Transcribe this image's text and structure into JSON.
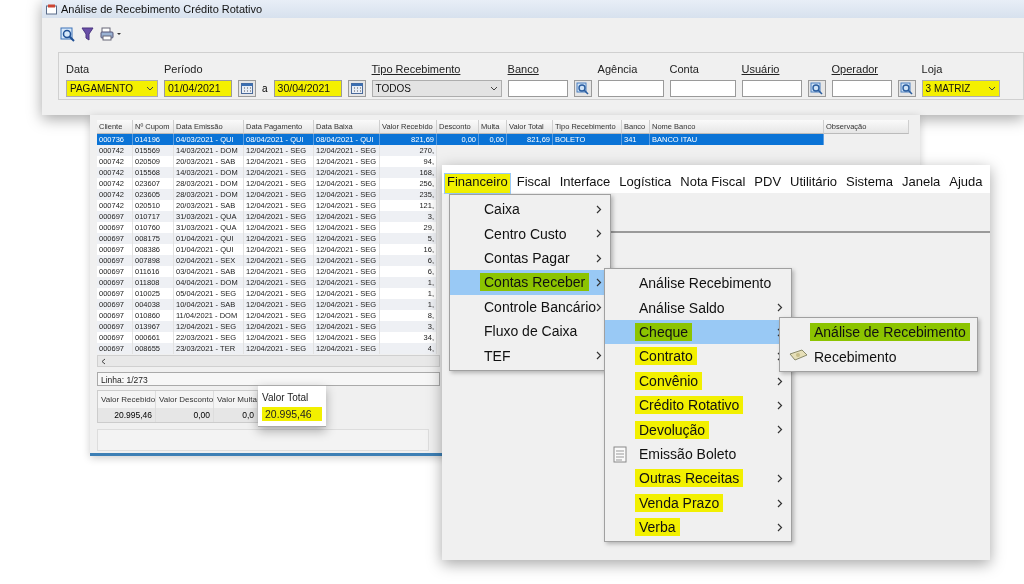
{
  "filter_window": {
    "title": "Análise de Recebimento Crédito Rotativo",
    "filters": [
      {
        "kind": "select",
        "label": "Data",
        "link": false,
        "value": "PAGAMENTO",
        "highlighted": true,
        "disabled": false
      },
      {
        "kind": "period",
        "label": "Período",
        "link": false,
        "from": "01/04/2021",
        "separator": "a",
        "to": "30/04/2021",
        "highlighted": true
      },
      {
        "kind": "select",
        "label": "Tipo Recebimento",
        "link": true,
        "value": "TODOS",
        "highlighted": false,
        "disabled": true
      },
      {
        "kind": "lookup",
        "label": "Banco",
        "link": true
      },
      {
        "kind": "text",
        "label": "Agência",
        "link": false
      },
      {
        "kind": "text",
        "label": "Conta",
        "link": false
      },
      {
        "kind": "lookup",
        "label": "Usuário",
        "link": true
      },
      {
        "kind": "lookup",
        "label": "Operador",
        "link": true
      },
      {
        "kind": "select",
        "label": "Loja",
        "link": false,
        "value": "3 MATRIZ",
        "highlighted": true,
        "disabled": false
      }
    ]
  },
  "table_window": {
    "columns": [
      "Cliente",
      "Nº Cupom",
      "Data Emissão",
      "Data Pagamento",
      "Data Baixa",
      "Valor Recebido",
      "Desconto",
      "Multa",
      "Valor Total",
      "Tipo Recebimento",
      "Banco",
      "Nome Banco",
      "Observação"
    ],
    "rows": [
      {
        "selected": true,
        "cells": [
          "000736",
          "014196",
          "04/03/2021 - QUI",
          "08/04/2021 - QUI",
          "08/04/2021 - QUI",
          "821,69",
          "0,00",
          "0,00",
          "821,69",
          "BOLETO",
          "341",
          "BANCO ITAU"
        ]
      },
      {
        "selected": false,
        "cells": [
          "000742",
          "015569",
          "14/03/2021 - DOM",
          "12/04/2021 - SEG",
          "12/04/2021 - SEG",
          "270,"
        ]
      },
      {
        "selected": false,
        "cells": [
          "000742",
          "020509",
          "20/03/2021 - SAB",
          "12/04/2021 - SEG",
          "12/04/2021 - SEG",
          "94,"
        ]
      },
      {
        "selected": false,
        "cells": [
          "000742",
          "015568",
          "14/03/2021 - DOM",
          "12/04/2021 - SEG",
          "12/04/2021 - SEG",
          "168,"
        ]
      },
      {
        "selected": false,
        "cells": [
          "000742",
          "023607",
          "28/03/2021 - DOM",
          "12/04/2021 - SEG",
          "12/04/2021 - SEG",
          "256,"
        ]
      },
      {
        "selected": false,
        "cells": [
          "000742",
          "023605",
          "28/03/2021 - DOM",
          "12/04/2021 - SEG",
          "12/04/2021 - SEG",
          "235,"
        ]
      },
      {
        "selected": false,
        "cells": [
          "000742",
          "020510",
          "20/03/2021 - SAB",
          "12/04/2021 - SEG",
          "12/04/2021 - SEG",
          "121,"
        ]
      },
      {
        "selected": false,
        "cells": [
          "000697",
          "010717",
          "31/03/2021 - QUA",
          "12/04/2021 - SEG",
          "12/04/2021 - SEG",
          "3,"
        ]
      },
      {
        "selected": false,
        "cells": [
          "000697",
          "010760",
          "31/03/2021 - QUA",
          "12/04/2021 - SEG",
          "12/04/2021 - SEG",
          "29,"
        ]
      },
      {
        "selected": false,
        "cells": [
          "000697",
          "008175",
          "01/04/2021 - QUI",
          "12/04/2021 - SEG",
          "12/04/2021 - SEG",
          "5,"
        ]
      },
      {
        "selected": false,
        "cells": [
          "000697",
          "008386",
          "01/04/2021 - QUI",
          "12/04/2021 - SEG",
          "12/04/2021 - SEG",
          "16,"
        ]
      },
      {
        "selected": false,
        "cells": [
          "000697",
          "007898",
          "02/04/2021 - SEX",
          "12/04/2021 - SEG",
          "12/04/2021 - SEG",
          "6,"
        ]
      },
      {
        "selected": false,
        "cells": [
          "000697",
          "011616",
          "03/04/2021 - SAB",
          "12/04/2021 - SEG",
          "12/04/2021 - SEG",
          "6,"
        ]
      },
      {
        "selected": false,
        "cells": [
          "000697",
          "011808",
          "04/04/2021 - DOM",
          "12/04/2021 - SEG",
          "12/04/2021 - SEG",
          "1,"
        ]
      },
      {
        "selected": false,
        "cells": [
          "000697",
          "010025",
          "05/04/2021 - SEG",
          "12/04/2021 - SEG",
          "12/04/2021 - SEG",
          "1,"
        ]
      },
      {
        "selected": false,
        "cells": [
          "000697",
          "004038",
          "10/04/2021 - SAB",
          "12/04/2021 - SEG",
          "12/04/2021 - SEG",
          "1,"
        ]
      },
      {
        "selected": false,
        "cells": [
          "000697",
          "010860",
          "11/04/2021 - DOM",
          "12/04/2021 - SEG",
          "12/04/2021 - SEG",
          "8,"
        ]
      },
      {
        "selected": false,
        "cells": [
          "000697",
          "013967",
          "12/04/2021 - SEG",
          "12/04/2021 - SEG",
          "12/04/2021 - SEG",
          "3,"
        ]
      },
      {
        "selected": false,
        "cells": [
          "000697",
          "000661",
          "22/03/2021 - SEG",
          "12/04/2021 - SEG",
          "12/04/2021 - SEG",
          "34,"
        ]
      },
      {
        "selected": false,
        "cells": [
          "000697",
          "008655",
          "23/03/2021 - TER",
          "12/04/2021 - SEG",
          "12/04/2021 - SEG",
          "4,"
        ]
      }
    ],
    "status": "Linha: 1/273",
    "summary": [
      {
        "label": "Valor Recebido",
        "value": "20.995,46"
      },
      {
        "label": "Valor Desconto",
        "value": "0,00"
      },
      {
        "label": "Valor Multa",
        "value": "0,0"
      }
    ]
  },
  "total_callout": {
    "label": "Valor Total",
    "value": "20.995,46",
    "highlighted": true
  },
  "menu_window": {
    "menubar": [
      {
        "label": "Financeiro",
        "selected": true,
        "highlighted": true
      },
      {
        "label": "Fiscal",
        "selected": false,
        "highlighted": false
      },
      {
        "label": "Interface",
        "selected": false,
        "highlighted": false
      },
      {
        "label": "Logística",
        "selected": false,
        "highlighted": false
      },
      {
        "label": "Nota Fiscal",
        "selected": false,
        "highlighted": false
      },
      {
        "label": "PDV",
        "selected": false,
        "highlighted": false
      },
      {
        "label": "Utilitário",
        "selected": false,
        "highlighted": false
      },
      {
        "label": "Sistema",
        "selected": false,
        "highlighted": false
      },
      {
        "label": "Janela",
        "selected": false,
        "highlighted": false
      },
      {
        "label": "Ajuda",
        "selected": false,
        "highlighted": false
      }
    ],
    "menus": [
      {
        "items": [
          {
            "kind": "submenu",
            "label": "Caixa",
            "selected": false
          },
          {
            "kind": "submenu",
            "label": "Centro Custo",
            "selected": false
          },
          {
            "kind": "submenu",
            "label": "Contas Pagar",
            "selected": false
          },
          {
            "kind": "submenu",
            "label": "Contas Receber",
            "selected": true,
            "color": "#8cc400"
          },
          {
            "kind": "submenu",
            "label": "Controle Bancário",
            "selected": false
          },
          {
            "kind": "plain",
            "label": "Fluxo de Caixa",
            "selected": false
          },
          {
            "kind": "submenu",
            "label": "TEF",
            "selected": false
          }
        ]
      },
      {
        "items": [
          {
            "kind": "plain",
            "label": "Análise Recebimento",
            "selected": false
          },
          {
            "kind": "submenu",
            "label": "Análise Saldo",
            "selected": false
          },
          {
            "kind": "submenu",
            "label": "Cheque",
            "selected": true,
            "color": "#8cc400"
          },
          {
            "kind": "submenu",
            "label": "Contrato",
            "selected": false,
            "color": "#f2f000"
          },
          {
            "kind": "submenu",
            "label": "Convênio",
            "selected": false,
            "color": "#f2f000"
          },
          {
            "kind": "submenu",
            "label": "Crédito Rotativo",
            "selected": false,
            "color": "#f2f000"
          },
          {
            "kind": "submenu",
            "label": "Devolução",
            "selected": false,
            "color": "#f2f000"
          },
          {
            "kind": "document",
            "label": "Emissão Boleto",
            "selected": false
          },
          {
            "kind": "submenu",
            "label": "Outras Receitas",
            "selected": false,
            "color": "#f2f000"
          },
          {
            "kind": "submenu",
            "label": "Venda Prazo",
            "selected": false,
            "color": "#f2f000"
          },
          {
            "kind": "submenu",
            "label": "Verba",
            "selected": false,
            "color": "#f2f000"
          }
        ]
      },
      {
        "items": [
          {
            "kind": "plain",
            "label": "Análise de Recebimento",
            "selected": false,
            "color": "#8cc400"
          },
          {
            "kind": "banknote",
            "label": "Recebimento",
            "selected": false
          }
        ]
      }
    ]
  }
}
